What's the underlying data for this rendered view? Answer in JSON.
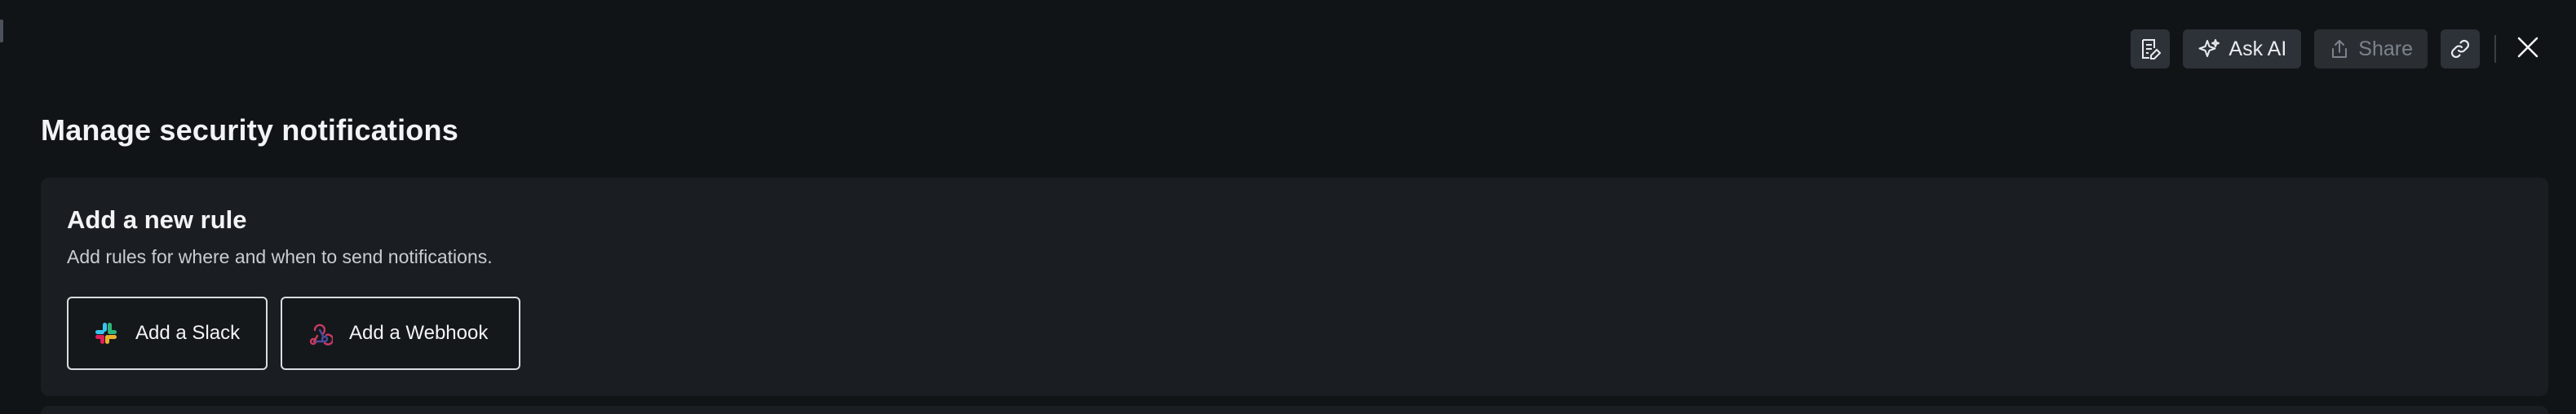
{
  "toolbar": {
    "edit_icon": "edit-page-icon",
    "ask_ai_label": "Ask AI",
    "ask_ai_icon": "sparkle-icon",
    "share_label": "Share",
    "share_icon": "share-icon",
    "share_disabled": true,
    "link_icon": "link-icon",
    "close_icon": "close-icon"
  },
  "page": {
    "title": "Manage security notifications"
  },
  "rule_card": {
    "title": "Add a new rule",
    "description": "Add rules for where and when to send notifications.",
    "buttons": [
      {
        "label": "Add a Slack",
        "icon": "slack-icon"
      },
      {
        "label": "Add a Webhook",
        "icon": "webhook-icon"
      }
    ]
  },
  "colors": {
    "background": "#111417",
    "card": "#1a1e22",
    "toolbar_button": "#2d3238",
    "text_primary": "#f1f3f5",
    "text_secondary": "#c9cdd2",
    "webhook_accent": "#c73a63"
  }
}
